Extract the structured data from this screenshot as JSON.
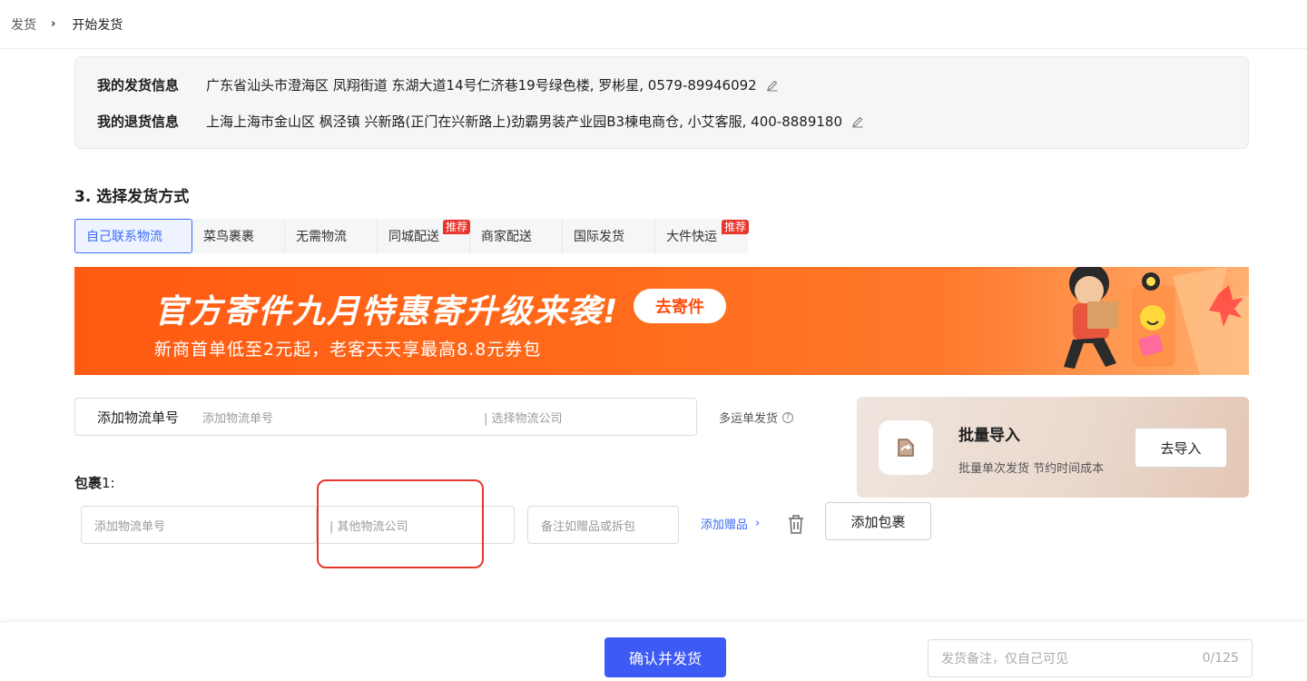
{
  "breadcrumb": {
    "parent": "发货",
    "current": "开始发货"
  },
  "address_info": {
    "ship": {
      "label": "我的发货信息",
      "value": "广东省汕头市澄海区 凤翔街道 东湖大道14号仁济巷19号绿色楼, 罗彬星, 0579-89946092"
    },
    "return": {
      "label": "我的退货信息",
      "value": "上海上海市金山区 枫泾镇 兴新路(正门在兴新路上)劲霸男装产业园B3棟电商仓, 小艾客服, 400-8889180"
    }
  },
  "section": {
    "title": "3. 选择发货方式"
  },
  "tabs": [
    {
      "label": "自己联系物流",
      "badge": ""
    },
    {
      "label": "菜鸟裹裹",
      "badge": ""
    },
    {
      "label": "无需物流",
      "badge": ""
    },
    {
      "label": "同城配送",
      "badge": "推荐"
    },
    {
      "label": "商家配送",
      "badge": ""
    },
    {
      "label": "国际发货",
      "badge": ""
    },
    {
      "label": "大件快运",
      "badge": "推荐"
    }
  ],
  "banner": {
    "headline": "官方寄件九月特惠寄升级来袭!",
    "subline": "新商首单低至2元起，老客天天享最高8.8元券包",
    "button": "去寄件"
  },
  "add_tracking": {
    "label": "添加物流单号",
    "placeholder": "添加物流单号",
    "company_placeholder": "| 选择物流公司"
  },
  "multi_waybill": {
    "label": "多运单发货",
    "help_icon": "question-icon"
  },
  "batch_import": {
    "title": "批量导入",
    "desc": "批量单次发货  节约时间成本",
    "button": "去导入"
  },
  "package": {
    "label": "包裹",
    "index": "1:",
    "tracking_placeholder": "添加物流单号",
    "company_value": "| 其他物流公司",
    "remark_placeholder": "备注如赠品或拆包",
    "gift_link": "添加赠品",
    "add_button": "添加包裹"
  },
  "footer": {
    "confirm": "确认并发货",
    "note_placeholder": "发货备注，仅自己可见",
    "note_count": "0/125"
  },
  "colors": {
    "accent": "#3d5af5",
    "banner": "#ff5a12",
    "badge": "#e8362d"
  }
}
